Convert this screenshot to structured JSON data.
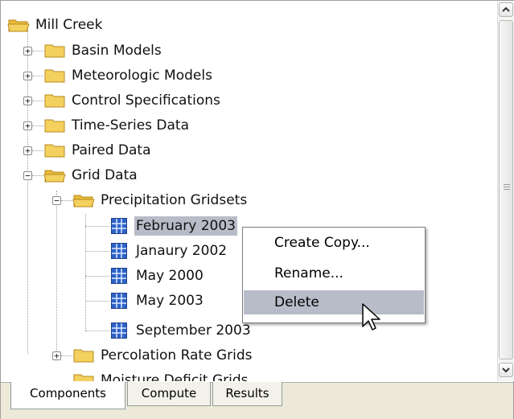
{
  "tree": {
    "root": "Mill Creek",
    "items": [
      {
        "label": "Basin Models"
      },
      {
        "label": "Meteorologic Models"
      },
      {
        "label": "Control Specifications"
      },
      {
        "label": "Time-Series Data"
      },
      {
        "label": "Paired Data"
      },
      {
        "label": "Grid Data"
      }
    ],
    "subfolder": "Precipitation Gridsets",
    "gridsets": [
      {
        "label": "February 2003"
      },
      {
        "label": "Janaury 2002"
      },
      {
        "label": "May 2000"
      },
      {
        "label": "May 2003"
      },
      {
        "label": "September 2003"
      }
    ],
    "after": [
      {
        "label": "Percolation Rate Grids"
      },
      {
        "label": "Moisture Deficit Grids"
      }
    ],
    "expander_plus": "+",
    "expander_minus": "−"
  },
  "context_menu": {
    "items": [
      {
        "label": "Create Copy..."
      },
      {
        "label": "Rename..."
      },
      {
        "label": "Delete"
      }
    ],
    "highlighted": "Delete"
  },
  "tabs": [
    {
      "label": "Components",
      "active": true
    },
    {
      "label": "Compute",
      "active": false
    },
    {
      "label": "Results",
      "active": false
    }
  ],
  "colors": {
    "folder": "#f4d15e",
    "selection": "#b8bcc8",
    "grid_icon": "#2d62c8"
  }
}
